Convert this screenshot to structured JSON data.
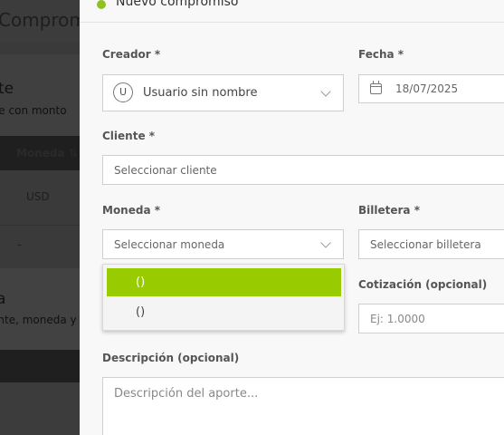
{
  "background": {
    "page_title": "Compromisos",
    "section1_title": "te",
    "section1_subtitle": "nte con monto",
    "table_header_moneda": "Moneda",
    "sort_glyph": "⇅",
    "row1_moneda": "USD",
    "row2_moneda": "-",
    "section2_title": "a",
    "section2_subtitle": "ente, moneda y"
  },
  "modal": {
    "title": "Nuevo compromiso",
    "creador": {
      "label": "Creador *",
      "value": "Usuario sin nombre",
      "avatar_initial": "U"
    },
    "fecha": {
      "label": "Fecha *",
      "value": "18/07/2025"
    },
    "cliente": {
      "label": "Cliente *",
      "placeholder": "Seleccionar cliente"
    },
    "moneda": {
      "label": "Moneda *",
      "placeholder": "Seleccionar moneda",
      "options": [
        {
          "label": "()",
          "selected": true
        },
        {
          "label": "()",
          "selected": false
        }
      ]
    },
    "billetera": {
      "label": "Billetera *",
      "placeholder": "Seleccionar billetera"
    },
    "cotizacion": {
      "label": "Cotización (opcional)",
      "placeholder": "Ej: 1.0000"
    },
    "descripcion": {
      "label": "Descripción (opcional)",
      "placeholder": "Descripción del aporte..."
    }
  },
  "colors": {
    "accent": "#99cc00",
    "panel_bg": "#f8f8f8",
    "overlay_bg": "#3a3a3a"
  },
  "icons": [
    "user-avatar-icon",
    "chevron-down-icon",
    "calendar-icon",
    "sort-icon",
    "header-badge-icon"
  ]
}
